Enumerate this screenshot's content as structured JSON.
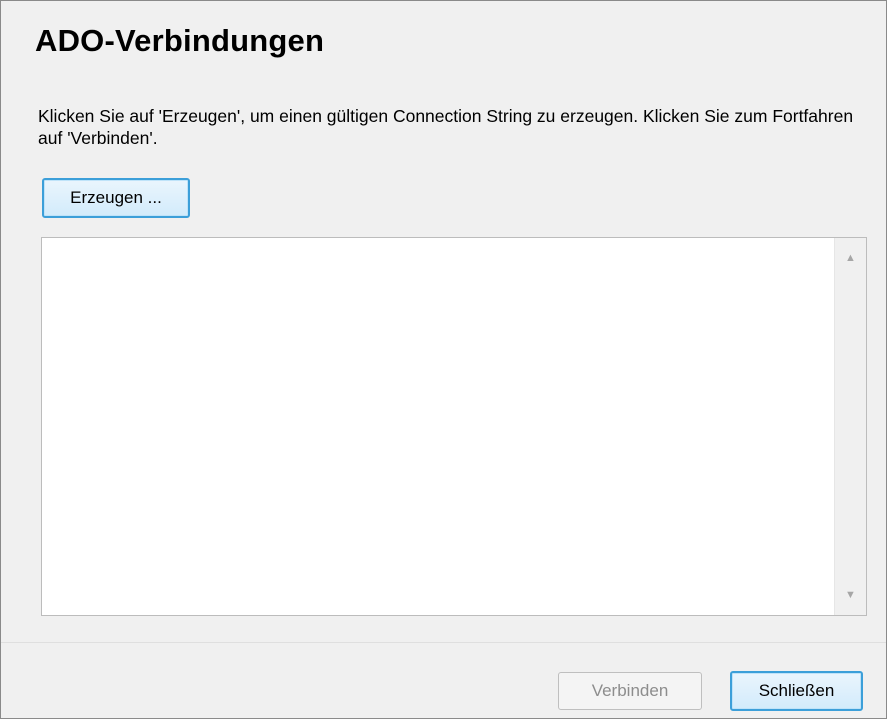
{
  "dialog": {
    "title": "ADO-Verbindungen",
    "instructions": "Klicken Sie auf 'Erzeugen', um einen gültigen Connection String zu erzeugen. Klicken Sie zum Fortfahren auf 'Verbinden'.",
    "generate_label": "Erzeugen ...",
    "connection_string": {
      "value": "",
      "scroll_up_icon": "triangle-up",
      "scroll_down_icon": "triangle-down"
    }
  },
  "footer": {
    "connect_label": "Verbinden",
    "connect_enabled": false,
    "close_label": "Schließen"
  },
  "colors": {
    "background": "#f0f0f0",
    "focus_border": "#3c9fd9",
    "disabled_text": "#8d8d8d"
  }
}
